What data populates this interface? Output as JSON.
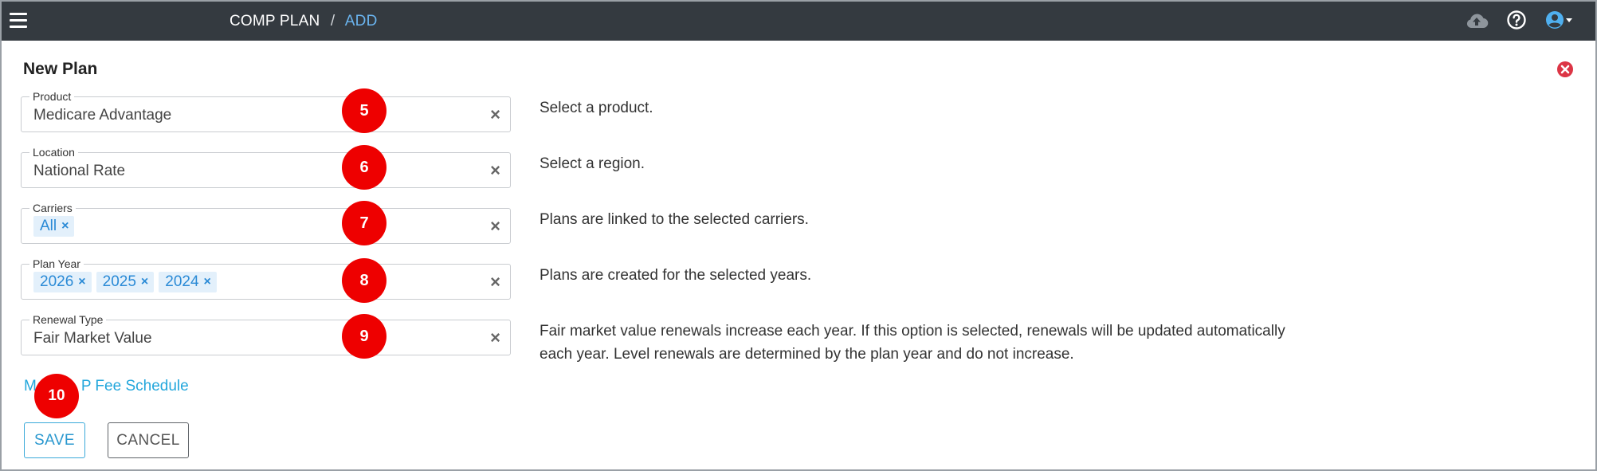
{
  "header": {
    "breadcrumb_root": "COMP PLAN",
    "breadcrumb_sep": "/",
    "breadcrumb_current": "ADD",
    "icons": [
      "menu-icon",
      "cloud-upload-icon",
      "help-icon",
      "user-account-icon"
    ]
  },
  "form": {
    "title": "New Plan",
    "fields": [
      {
        "label": "Product",
        "value": "Medicare Advantage",
        "help": "Select a product.",
        "marker": "5"
      },
      {
        "label": "Location",
        "value": "National Rate",
        "help": "Select a region.",
        "marker": "6"
      },
      {
        "label": "Carriers",
        "chips": [
          "All"
        ],
        "help": "Plans are linked to the selected carriers.",
        "marker": "7"
      },
      {
        "label": "Plan Year",
        "chips": [
          "2026",
          "2025",
          "2024"
        ],
        "help": "Plans are created for the selected years.",
        "marker": "8"
      },
      {
        "label": "Renewal Type",
        "value": "Fair Market Value",
        "help_line1": "Fair market value renewals increase each year. If this option is selected, renewals will be updated automatically",
        "help_line2": "each year. Level renewals are determined by the plan year and do not increase.",
        "marker": "9"
      }
    ],
    "link_text_left": "M",
    "link_text_right": "P Fee Schedule",
    "link_marker": "10",
    "clear_glyph": "×",
    "save_label": "SAVE",
    "cancel_label": "CANCEL"
  },
  "colors": {
    "topbar": "#343a40",
    "accent": "#2a98cf",
    "marker": "#ee0000",
    "close": "#dc3545"
  }
}
